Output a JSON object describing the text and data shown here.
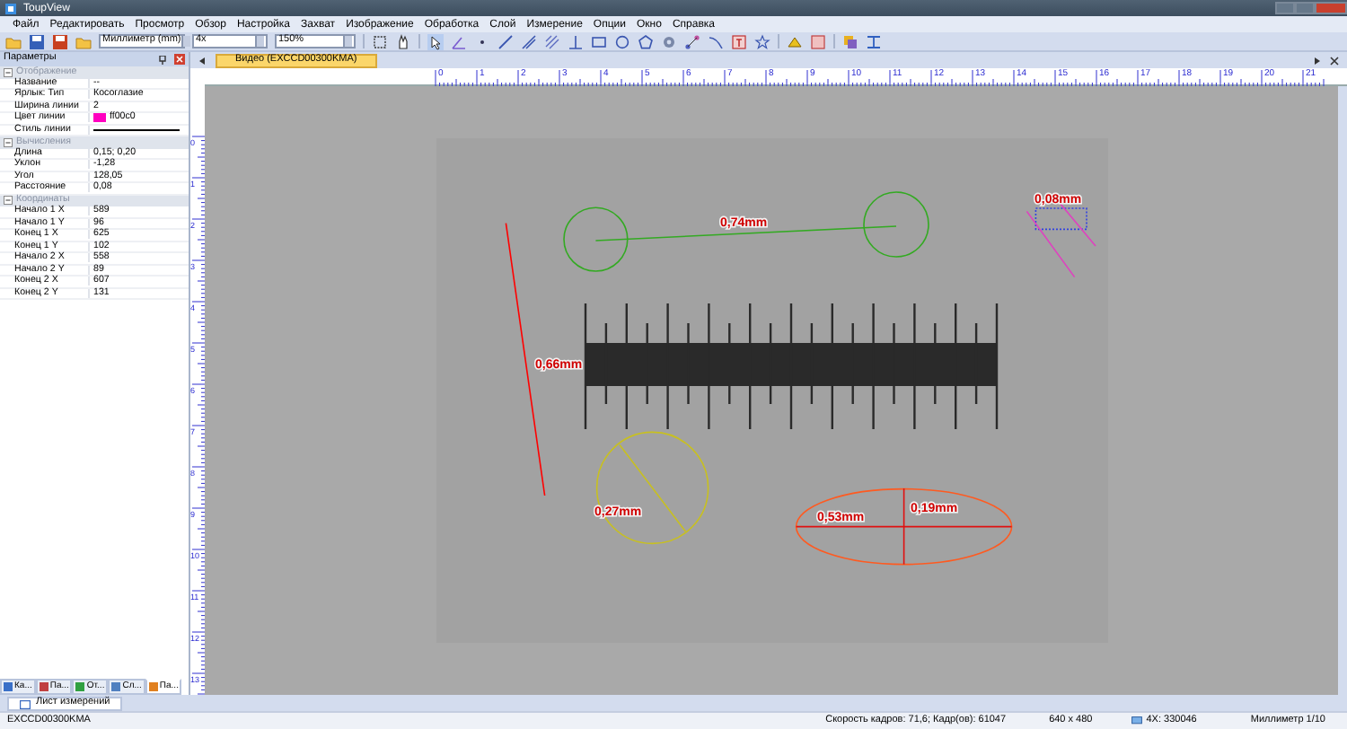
{
  "window": {
    "title": "ToupView"
  },
  "menu": [
    "Файл",
    "Редактировать",
    "Просмотр",
    "Обзор",
    "Настройка",
    "Захват",
    "Изображение",
    "Обработка",
    "Слой",
    "Измерение",
    "Опции",
    "Окно",
    "Справка"
  ],
  "toolbar": {
    "unit_select": "Миллиметр (mm)",
    "objective_select": "4x",
    "zoom_select": "150%"
  },
  "properties": {
    "title": "Параметры",
    "categories": [
      {
        "name": "Отображение",
        "expanded": true,
        "rows": [
          {
            "kind": "text",
            "name": "Название",
            "value": "--"
          },
          {
            "kind": "text",
            "name": "Ярлык: Тип",
            "value": "Косоглазие"
          },
          {
            "kind": "text",
            "name": "Ширина линии",
            "value": "2"
          },
          {
            "kind": "color",
            "name": "Цвет линии",
            "value": "ff00c0",
            "color": "#ff00c0"
          },
          {
            "kind": "line-style",
            "name": "Стиль линии"
          }
        ]
      },
      {
        "name": "Вычисления",
        "expanded": true,
        "rows": [
          {
            "kind": "text",
            "name": "Длина",
            "value": "0,15; 0,20"
          },
          {
            "kind": "text",
            "name": "Уклон",
            "value": "-1,28"
          },
          {
            "kind": "text",
            "name": "Угол",
            "value": "128,05"
          },
          {
            "kind": "text",
            "name": "Расстояние",
            "value": "0,08"
          }
        ]
      },
      {
        "name": "Координаты",
        "expanded": true,
        "rows": [
          {
            "kind": "text",
            "name": "Начало 1 X",
            "value": "589"
          },
          {
            "kind": "text",
            "name": "Начало 1 Y",
            "value": "96"
          },
          {
            "kind": "text",
            "name": "Конец 1 X",
            "value": "625"
          },
          {
            "kind": "text",
            "name": "Конец 1 Y",
            "value": "102"
          },
          {
            "kind": "text",
            "name": "Начало 2 X",
            "value": "558"
          },
          {
            "kind": "text",
            "name": "Начало 2 Y",
            "value": "89"
          },
          {
            "kind": "text",
            "name": "Конец 2 X",
            "value": "607"
          },
          {
            "kind": "text",
            "name": "Конец 2 Y",
            "value": "131"
          }
        ]
      }
    ]
  },
  "panel_tabs": [
    {
      "label": "Ка...",
      "selected": false
    },
    {
      "label": "Па...",
      "selected": false
    },
    {
      "label": "От...",
      "selected": false
    },
    {
      "label": "Сл...",
      "selected": false
    },
    {
      "label": "Па...",
      "selected": true
    }
  ],
  "document_tabs": [
    {
      "label": "Видео (EXCCD00300KMA)",
      "selected": true
    }
  ],
  "ruler": {
    "horizontal": [
      "0",
      "1",
      "2",
      "3",
      "4",
      "5",
      "6",
      "7",
      "8",
      "9",
      "10",
      "11",
      "12",
      "13",
      "14",
      "15",
      "16",
      "17",
      "18",
      "19",
      "20",
      "21"
    ],
    "vertical": [
      "0",
      "1",
      "2",
      "3",
      "4",
      "5",
      "6",
      "7",
      "8",
      "9",
      "10",
      "11",
      "12",
      "13"
    ]
  },
  "measurements": [
    {
      "kind": "line",
      "color": "#ff0000",
      "labels": [
        "0,66mm"
      ]
    },
    {
      "kind": "circle-distance",
      "color": "#33aa22",
      "labels": [
        "0,74mm"
      ]
    },
    {
      "kind": "parallel",
      "color": "#e040c0",
      "labels": [
        "0,08mm"
      ]
    },
    {
      "kind": "circle",
      "color": "#c8c020",
      "labels": [
        "0,27mm"
      ]
    },
    {
      "kind": "ellipse",
      "color": "#ff5a20",
      "labels": [
        "0,53mm",
        "0,19mm"
      ]
    }
  ],
  "bottom_tabs": [
    {
      "label": "Лист измерений",
      "selected": true
    }
  ],
  "status_bar": {
    "device": "EXCCD00300KMA",
    "frames": "Скорость кадров: 71,6; Кадр(ов): 61047",
    "resolution": "640 x 480",
    "objective": "4X: 330046",
    "scale": "Миллиметр 1/10"
  }
}
